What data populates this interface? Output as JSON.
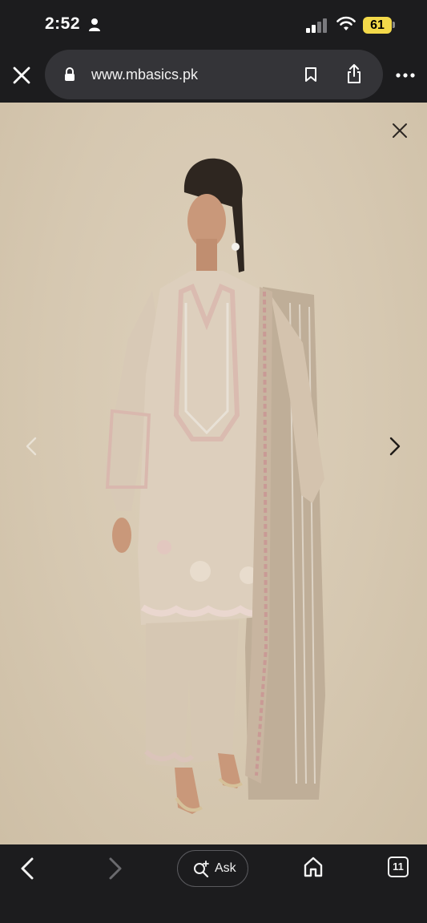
{
  "status_bar": {
    "time": "2:52",
    "battery": "61"
  },
  "browser": {
    "url": "www.mbasics.pk"
  },
  "toolbar": {
    "ask_label": "Ask",
    "tab_count": "11"
  },
  "icons": {
    "person": "person-icon",
    "signal": "cellular-signal-icon",
    "wifi": "wifi-icon",
    "close": "close-icon",
    "lock": "lock-icon",
    "bookmark": "bookmark-icon",
    "share": "share-icon",
    "more": "more-icon",
    "prev": "chevron-left-icon",
    "next": "chevron-right-icon",
    "back": "back-icon",
    "forward": "forward-icon",
    "ask": "ask-search-icon",
    "home": "home-icon",
    "tabs": "tabs-icon"
  },
  "colors": {
    "battery": "#f3d94a",
    "background_photo": "#d6c8b1",
    "chrome": "#1c1c1e"
  }
}
